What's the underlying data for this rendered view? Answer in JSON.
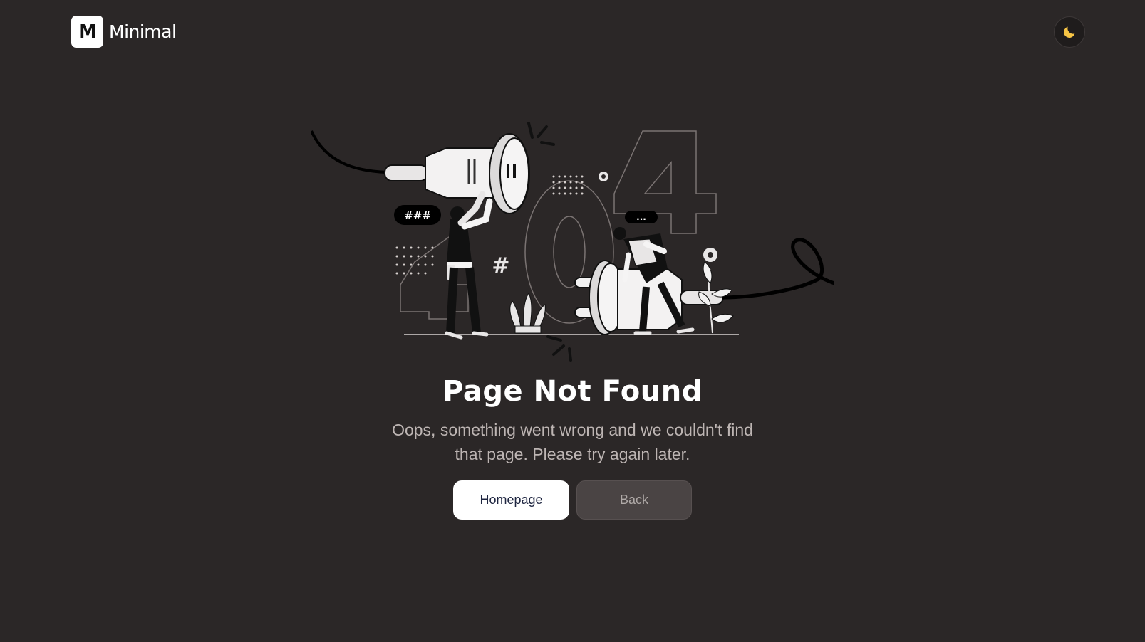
{
  "brand": {
    "mark": "M",
    "name": "Minimal"
  },
  "header": {
    "theme_toggle_icon": "moon-icon",
    "moon_color": "#f6c445"
  },
  "illustration": {
    "icon": "404-unplugged-illustration",
    "digits": [
      "4",
      "0",
      "4"
    ],
    "bubble_left": "###",
    "bubble_right": "...",
    "hash_symbol": "#"
  },
  "main": {
    "title": "Page Not Found",
    "message_line1": "Oops, something went wrong and we couldn't find",
    "message_line2": "that page. Please try again later.",
    "primary_button": "Homepage",
    "secondary_button": "Back"
  },
  "colors": {
    "background": "#2b2727",
    "primary_button_bg": "#ffffff",
    "primary_button_text": "#1e2540",
    "secondary_button_bg": "#4a4444"
  }
}
